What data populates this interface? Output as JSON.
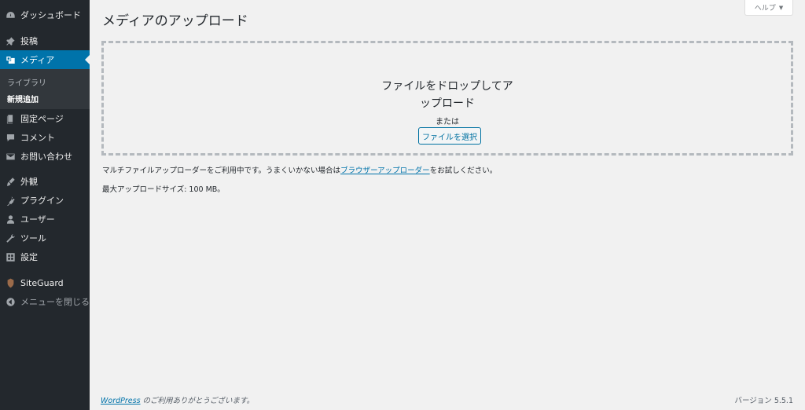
{
  "sidebar": {
    "dashboard": "ダッシュボード",
    "posts": "投稿",
    "media": "メディア",
    "media_sub": [
      "ライブラリ",
      "新規追加"
    ],
    "pages": "固定ページ",
    "comments": "コメント",
    "contact": "お問い合わせ",
    "appearance": "外観",
    "plugins": "プラグイン",
    "users": "ユーザー",
    "tools": "ツール",
    "settings": "設定",
    "siteguard": "SiteGuard",
    "collapse": "メニューを閉じる"
  },
  "header": {
    "title": "メディアのアップロード",
    "help": "ヘルプ"
  },
  "upload": {
    "drop_line1": "ファイルをドロップしてア",
    "drop_line2": "ップロード",
    "or": "または",
    "select_button": "ファイルを選択"
  },
  "info": {
    "multi_prefix": "マルチファイルアップローダーをご利用中です。うまくいかない場合は",
    "browser_link": "ブラウザーアップローダー",
    "multi_suffix": "をお試しください。",
    "max_size": "最大アップロードサイズ: 100 MB。"
  },
  "footer": {
    "wp_link": "WordPress",
    "thanks": " のご利用ありがとうございます。",
    "version": "バージョン 5.5.1"
  },
  "colors": {
    "sidebar_bg": "#23282d",
    "active_bg": "#0073aa",
    "link": "#0073aa"
  }
}
